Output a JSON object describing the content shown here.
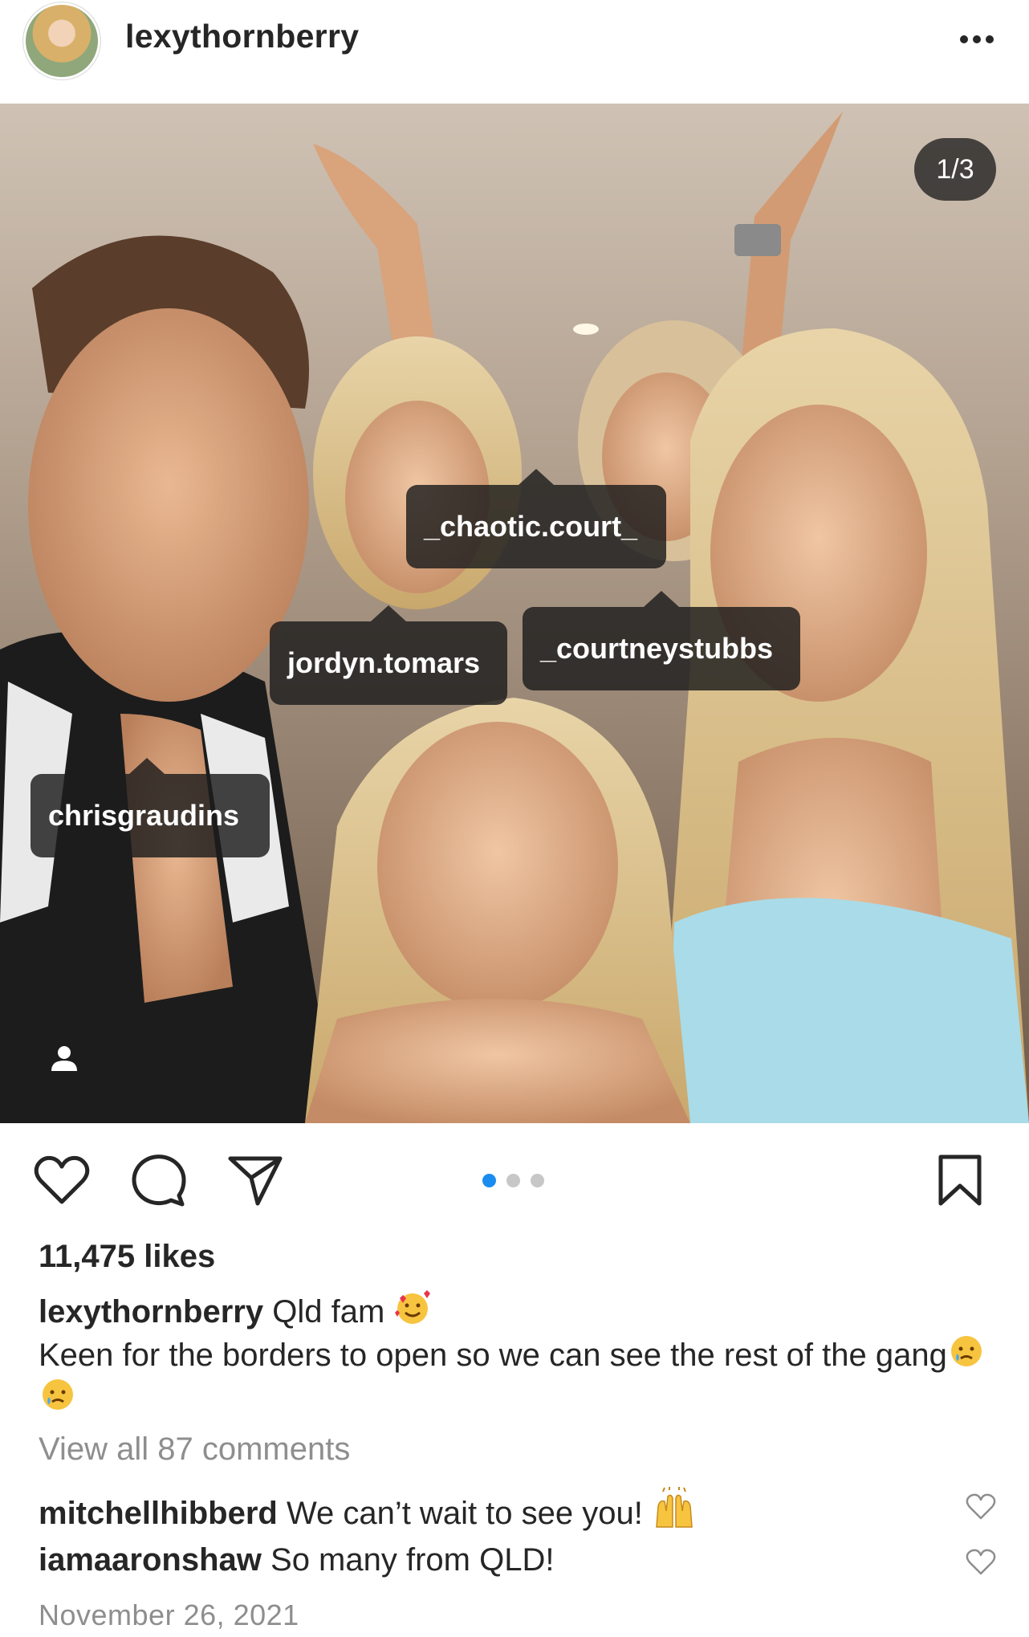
{
  "header": {
    "username": "lexythornberry",
    "avatar_icon": "profile-avatar",
    "more_icon": "ellipsis-icon"
  },
  "photo": {
    "counter": "1/3",
    "tags": {
      "chaotic": "_chaotic.court_",
      "jordyn": "jordyn.tomars",
      "courtney": "_courtneystubbs",
      "chris": "chrisgraudins"
    },
    "user_tag_icon": "person-icon"
  },
  "actions": {
    "like_icon": "heart-icon",
    "comment_icon": "comment-bubble-icon",
    "share_icon": "paper-plane-icon",
    "save_icon": "bookmark-icon",
    "carousel": {
      "total": 3,
      "active": 1,
      "active_color": "#1a8cf0"
    }
  },
  "post": {
    "likes": "11,475 likes",
    "caption_user": "lexythornberry",
    "caption_line1": "Qld fam",
    "caption_emoji1": "smiling-face-with-hearts",
    "caption_line2": "Keen for the borders to open so we can see the rest of the gang",
    "caption_emoji2": "crying-face",
    "view_all": "View all 87 comments",
    "comments": [
      {
        "user": "mitchellhibberd",
        "text": "We can’t wait to see you!",
        "emoji": "raising-hands"
      },
      {
        "user": "iamaaronshaw",
        "text": "So many from QLD!"
      }
    ],
    "date": "November 26, 2021"
  }
}
